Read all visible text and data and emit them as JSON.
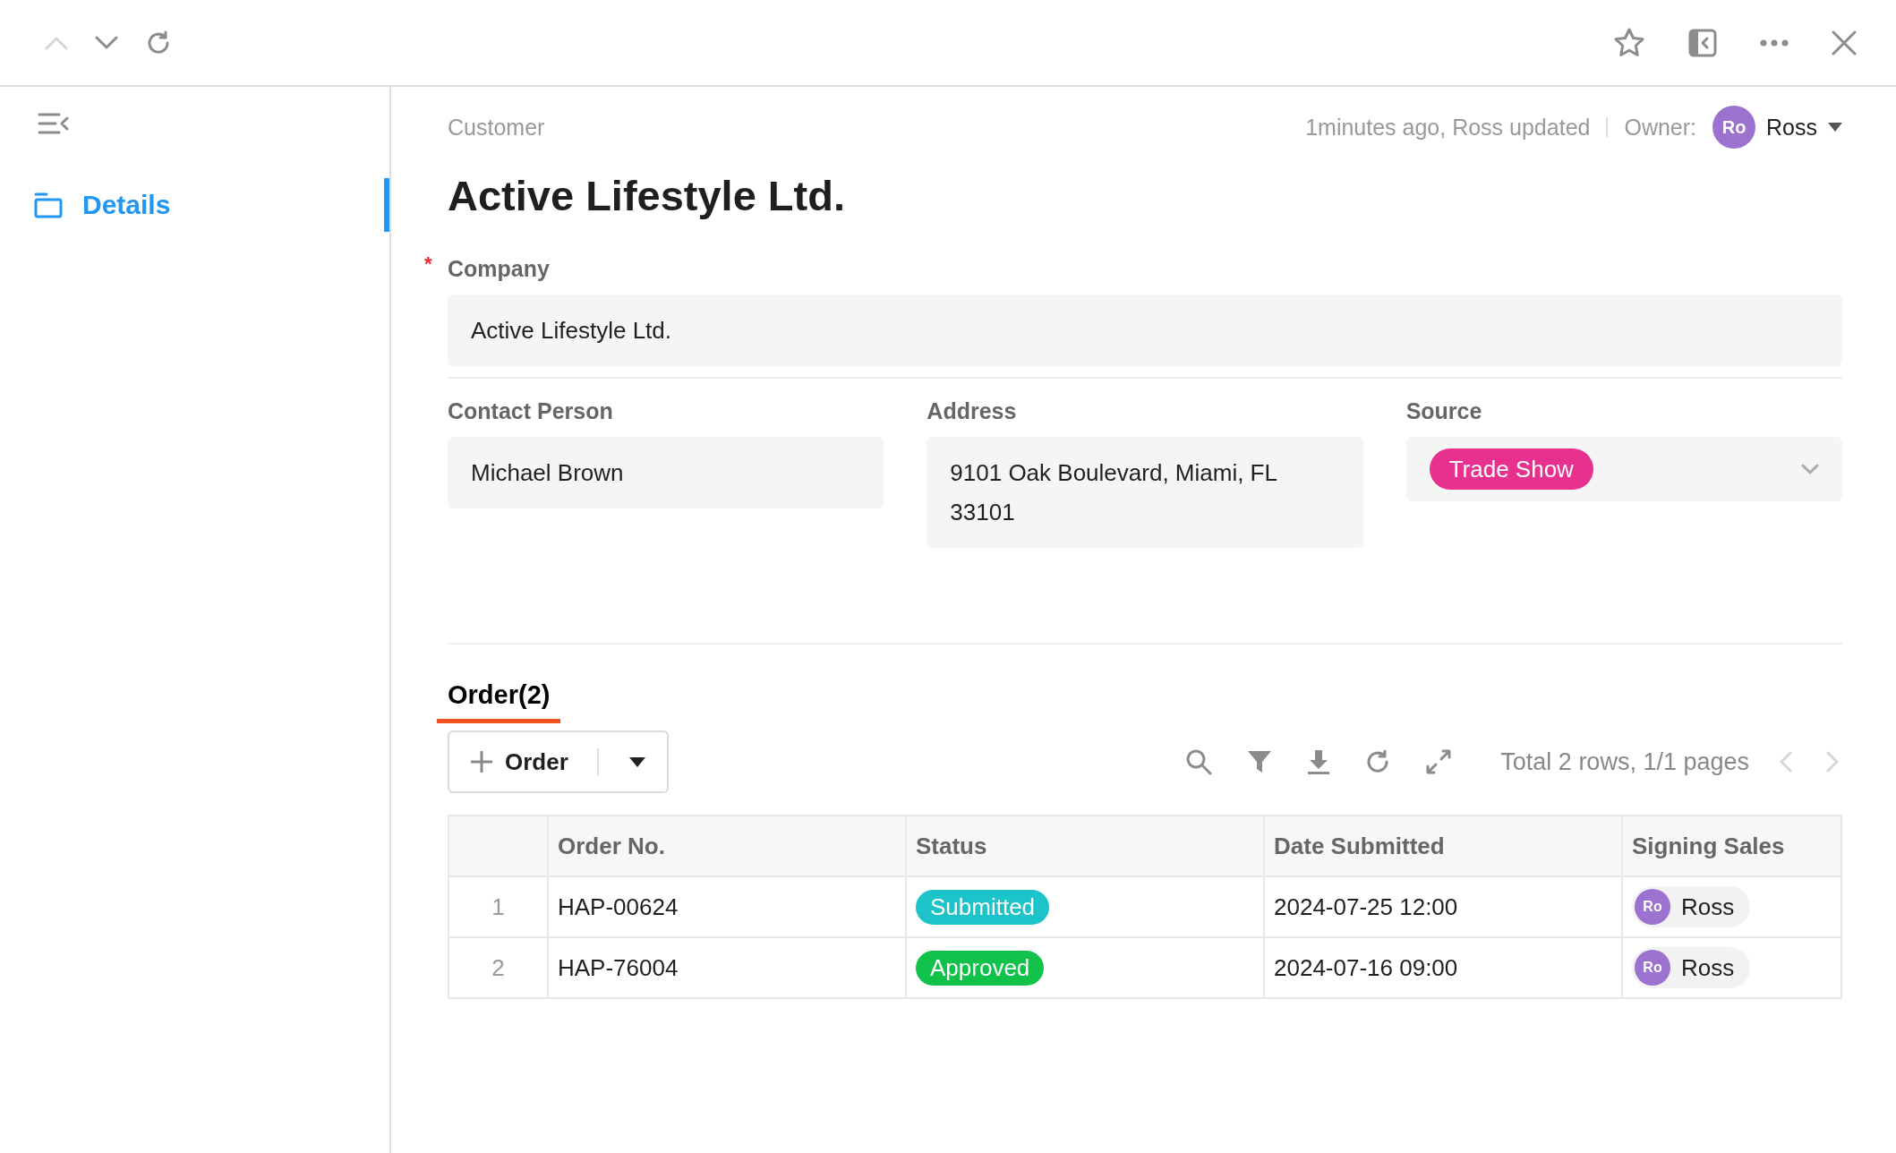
{
  "toolbar": {
    "nav": [
      {
        "kind": "up",
        "disabled": true
      },
      {
        "kind": "down",
        "disabled": false
      },
      {
        "kind": "refresh",
        "disabled": false
      }
    ],
    "actions": [
      {
        "kind": "star"
      },
      {
        "kind": "panel"
      },
      {
        "kind": "more"
      },
      {
        "kind": "close"
      }
    ]
  },
  "sidebar": {
    "items": [
      {
        "label": "Details",
        "selected": true
      }
    ]
  },
  "header": {
    "breadcrumb": "Customer",
    "updated": "1minutes ago, Ross updated",
    "owner_label": "Owner:",
    "owner": {
      "initials": "Ro",
      "name": "Ross"
    }
  },
  "title": "Active Lifestyle Ltd.",
  "company_field": {
    "label": "Company",
    "required_mark": "*",
    "value": "Active Lifestyle Ltd."
  },
  "fields": [
    {
      "kind": "text",
      "label": "Contact Person",
      "value": "Michael Brown"
    },
    {
      "kind": "text",
      "label": "Address",
      "value": "9101 Oak Boulevard, Miami, FL 33101"
    },
    {
      "kind": "select",
      "label": "Source",
      "value": "Trade Show",
      "color": "#e8318f"
    }
  ],
  "tabs": [
    {
      "label": "Order(2)",
      "selected": true
    }
  ],
  "add_button": {
    "label": "Order"
  },
  "table_tools": [
    {
      "kind": "search"
    },
    {
      "kind": "filter"
    },
    {
      "kind": "download"
    },
    {
      "kind": "refresh"
    },
    {
      "kind": "expand"
    }
  ],
  "pagination": {
    "summary": "Total 2 rows, 1/1 pages",
    "prev_disabled": true,
    "next_disabled": true
  },
  "table": {
    "columns": [
      "Order No.",
      "Status",
      "Date Submitted",
      "Signing Sales"
    ],
    "rows": [
      {
        "index": "1",
        "order_no": "HAP-00624",
        "status": {
          "label": "Submitted",
          "color": "#1cc3c9"
        },
        "date": "2024-07-25 12:00",
        "sales": {
          "initials": "Ro",
          "name": "Ross"
        }
      },
      {
        "index": "2",
        "order_no": "HAP-76004",
        "status": {
          "label": "Approved",
          "color": "#10c24a"
        },
        "date": "2024-07-16 09:00",
        "sales": {
          "initials": "Ro",
          "name": "Ross"
        }
      }
    ]
  }
}
